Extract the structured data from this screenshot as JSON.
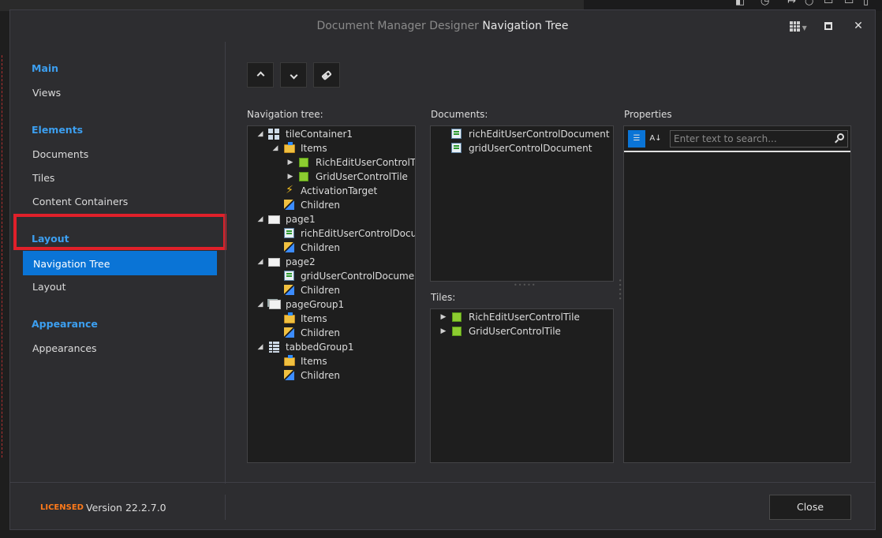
{
  "window": {
    "title_prefix": "Document Manager Designer",
    "title_main": "Navigation Tree"
  },
  "sidebar": {
    "groups": [
      {
        "label": "Main",
        "items": [
          {
            "label": "Views"
          }
        ]
      },
      {
        "label": "Elements",
        "items": [
          {
            "label": "Documents"
          },
          {
            "label": "Tiles"
          },
          {
            "label": "Content Containers"
          }
        ]
      },
      {
        "label": "Layout",
        "items": [
          {
            "label": "Navigation Tree",
            "selected": true
          },
          {
            "label": "Layout"
          }
        ]
      },
      {
        "label": "Appearance",
        "items": [
          {
            "label": "Appearances"
          }
        ]
      }
    ]
  },
  "toolbar": {
    "icons": [
      "chevron-up-icon",
      "chevron-down-icon",
      "eraser-icon"
    ]
  },
  "navigation_tree": {
    "label": "Navigation tree:",
    "nodes": [
      {
        "text": "tileContainer1",
        "icon": "tile-container-icon",
        "expander": "expanded"
      },
      {
        "text": "Items",
        "icon": "items-folder-icon",
        "expander": "expanded"
      },
      {
        "text": "RichEditUserControlTile",
        "icon": "tile-icon",
        "expander": "collapsed"
      },
      {
        "text": "GridUserControlTile",
        "icon": "tile-icon",
        "expander": "collapsed"
      },
      {
        "text": "ActivationTarget",
        "icon": "lightning-icon",
        "expander": "none"
      },
      {
        "text": "Children",
        "icon": "children-icon",
        "expander": "none"
      },
      {
        "text": "page1",
        "icon": "page-icon",
        "expander": "expanded"
      },
      {
        "text": "richEditUserControlDocume",
        "icon": "document-icon",
        "expander": "none"
      },
      {
        "text": "Children",
        "icon": "children-icon",
        "expander": "none"
      },
      {
        "text": "page2",
        "icon": "page-icon",
        "expander": "expanded"
      },
      {
        "text": "gridUserControlDocument",
        "icon": "document-icon",
        "expander": "none"
      },
      {
        "text": "Children",
        "icon": "children-icon",
        "expander": "none"
      },
      {
        "text": "pageGroup1",
        "icon": "page-group-icon",
        "expander": "expanded"
      },
      {
        "text": "Items",
        "icon": "items-folder-icon",
        "expander": "none"
      },
      {
        "text": "Children",
        "icon": "children-icon",
        "expander": "none"
      },
      {
        "text": "tabbedGroup1",
        "icon": "tabbed-group-icon",
        "expander": "expanded"
      },
      {
        "text": "Items",
        "icon": "items-folder-icon",
        "expander": "none"
      },
      {
        "text": "Children",
        "icon": "children-icon",
        "expander": "none"
      }
    ]
  },
  "documents": {
    "label": "Documents:",
    "items": [
      {
        "text": "richEditUserControlDocument",
        "icon": "document-icon"
      },
      {
        "text": "gridUserControlDocument",
        "icon": "document-icon"
      }
    ]
  },
  "tiles": {
    "label": "Tiles:",
    "items": [
      {
        "text": "RichEditUserControlTile",
        "icon": "tile-icon"
      },
      {
        "text": "GridUserControlTile",
        "icon": "tile-icon"
      }
    ]
  },
  "properties": {
    "label": "Properties",
    "search_placeholder": "Enter text to search..."
  },
  "footer": {
    "licensed": "LICENSED",
    "version": "Version 22.2.7.0",
    "close_label": "Close"
  },
  "colors": {
    "accent": "#0a74d6",
    "group_header": "#3c9ff0",
    "licensed": "#ff7a1a",
    "highlight_box": "#e0202a"
  }
}
